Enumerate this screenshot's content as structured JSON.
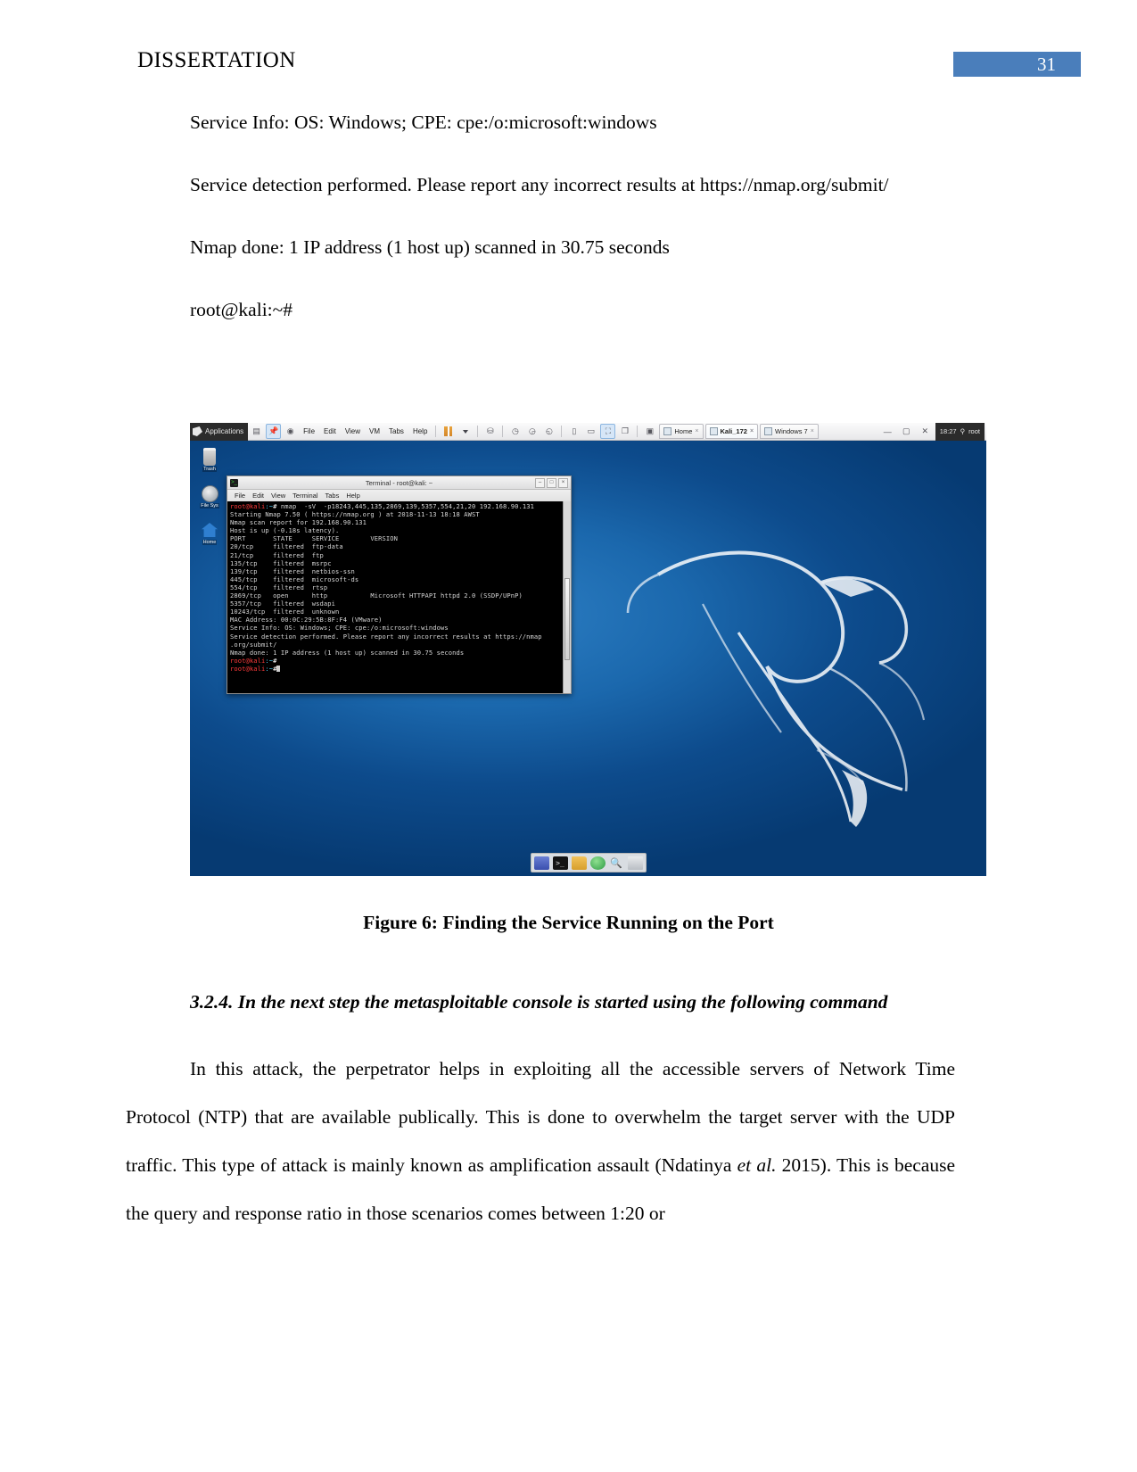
{
  "header": {
    "doc_title": "DISSERTATION",
    "page_number": "31",
    "badge_color": "#4a7ebb"
  },
  "body": {
    "line_service_info": "Service Info: OS: Windows; CPE: cpe:/o:microsoft:windows",
    "para_service_detection": "Service detection performed. Please report any incorrect results at https://nmap.org/submit/",
    "line_nmap_done": "Nmap done: 1 IP address (1 host up) scanned in 30.75 seconds",
    "line_prompt": "root@kali:~#"
  },
  "figure": {
    "caption": "Figure 6: Finding the Service Running on the Port"
  },
  "screenshot": {
    "vm_toolbar": {
      "applications_label": "Applications",
      "menu_items": [
        "File",
        "Edit",
        "View",
        "VM",
        "Tabs",
        "Help"
      ],
      "tabs": [
        {
          "label": "Home",
          "close": "×"
        },
        {
          "label": "Kali_172",
          "close": "×"
        },
        {
          "label": "Windows 7",
          "close": "×"
        }
      ],
      "clock": "18:27",
      "user": "root"
    },
    "desktop_icons": [
      {
        "name": "trash-icon",
        "label": "Trash"
      },
      {
        "name": "home-icon",
        "label": "Home"
      },
      {
        "name": "filesystem-icon",
        "label": "File Sys"
      }
    ],
    "terminal": {
      "title": "Terminal - root@kali: ~",
      "menu_items": [
        "File",
        "Edit",
        "View",
        "Terminal",
        "Tabs",
        "Help"
      ],
      "window_buttons": [
        "–",
        "□",
        "×"
      ],
      "prompt_user": "root@kali",
      "prompt_path": ":~",
      "prompt_tail": "# ",
      "command": "nmap  -sV  -p18243,445,135,2869,139,5357,554,21,20 192.168.90.131",
      "output_lines": [
        "",
        "Starting Nmap 7.50 ( https://nmap.org ) at 2018-11-13 18:18 AWST",
        "Nmap scan report for 192.168.90.131",
        "Host is up (-0.18s latency).",
        "",
        "PORT       STATE     SERVICE        VERSION",
        "20/tcp     filtered  ftp-data",
        "21/tcp     filtered  ftp",
        "135/tcp    filtered  msrpc",
        "139/tcp    filtered  netbios-ssn",
        "445/tcp    filtered  microsoft-ds",
        "554/tcp    filtered  rtsp",
        "2869/tcp   open      http           Microsoft HTTPAPI httpd 2.0 (SSDP/UPnP)",
        "5357/tcp   filtered  wsdapi",
        "10243/tcp  filtered  unknown",
        "MAC Address: 00:0C:29:5B:8F:F4 (VMware)",
        "Service Info: OS: Windows; CPE: cpe:/o:microsoft:windows",
        "",
        "Service detection performed. Please report any incorrect results at https://nmap",
        ".org/submit/",
        "Nmap done: 1 IP address (1 host up) scanned in 30.75 seconds"
      ],
      "final_prompt_user": "root@kali",
      "final_prompt_path": ":~",
      "final_prompt_tail": "#"
    },
    "dock_items": [
      "firefox-icon",
      "terminal-icon",
      "folder-icon",
      "browser-globe-icon",
      "search-icon",
      "files-icon"
    ]
  },
  "lower_body": {
    "section_heading": "3.2.4. In the next step the metasploitable console is started using the following command",
    "paragraph_part1": "In this attack, the perpetrator helps in exploiting all the accessible servers of Network Time Protocol (NTP) that are available publically. This is done to overwhelm the target server with the UDP traffic. This type of attack is mainly known as amplification assault (Ndatinya ",
    "paragraph_italic1": "et al.",
    "paragraph_part2": " 2015). This is because the query and response ratio in those scenarios comes between 1:20 or"
  }
}
